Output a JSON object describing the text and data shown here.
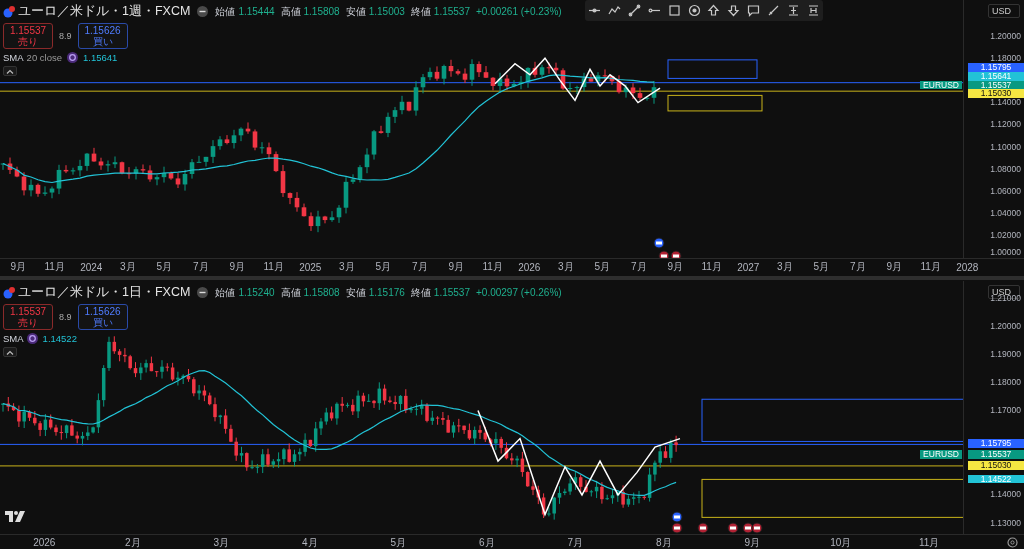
{
  "panes": [
    {
      "title": "ユーロ／米ドル・1週・FXCM",
      "ohlc": [
        {
          "label": "始値",
          "value": "1.15444"
        },
        {
          "label": "高値",
          "value": "1.15808"
        },
        {
          "label": "安値",
          "value": "1.15003"
        },
        {
          "label": "終値",
          "value": "1.15537"
        }
      ],
      "change": "+0.00261 (+0.23%)",
      "sell": {
        "price": "1.15537",
        "label": "売り"
      },
      "spread": "8.9",
      "buy": {
        "price": "1.15626",
        "label": "買い"
      },
      "indicator": {
        "name": "SMA",
        "params": "20 close",
        "value": "1.15641"
      },
      "currency": "USD",
      "price_ticks": [
        "1.20000",
        "1.18000",
        "1.14000",
        "1.12000",
        "1.10000",
        "1.08000",
        "1.06000",
        "1.04000",
        "1.02000",
        "1.00000"
      ],
      "price_tags": [
        {
          "price": "1.15795",
          "color": "#2962ff",
          "kind": "line"
        },
        {
          "price": "1.15641",
          "color": "#22c3d6",
          "kind": "sma"
        },
        {
          "price": "1.15537",
          "color": "#089981",
          "kind": "current"
        },
        {
          "price": "1.15030",
          "color": "#f5e642",
          "kind": "line"
        }
      ],
      "symbol_label": "EURUSD",
      "time_labels": [
        "9月",
        "11月",
        "2024",
        "3月",
        "5月",
        "7月",
        "9月",
        "11月",
        "2025",
        "3月",
        "5月",
        "7月",
        "9月",
        "11月",
        "2026",
        "3月",
        "5月",
        "7月",
        "9月",
        "11月",
        "2027",
        "3月",
        "5月",
        "7月",
        "9月",
        "11月",
        "2028"
      ]
    },
    {
      "title": "ユーロ／米ドル・1日・FXCM",
      "ohlc": [
        {
          "label": "始値",
          "value": "1.15240"
        },
        {
          "label": "高値",
          "value": "1.15808"
        },
        {
          "label": "安値",
          "value": "1.15176"
        },
        {
          "label": "終値",
          "value": "1.15537"
        }
      ],
      "change": "+0.00297 (+0.26%)",
      "sell": {
        "price": "1.15537",
        "label": "売り"
      },
      "spread": "8.9",
      "buy": {
        "price": "1.15626",
        "label": "買い"
      },
      "indicator": {
        "name": "SMA",
        "value": "1.14522"
      },
      "currency": "USD",
      "price_ticks": [
        "1.21000",
        "1.20000",
        "1.19000",
        "1.18000",
        "1.17000",
        "1.14000",
        "1.13000"
      ],
      "price_tags": [
        {
          "price": "1.15795",
          "color": "#2962ff",
          "kind": "line"
        },
        {
          "price": "1.15537",
          "color": "#089981",
          "kind": "current"
        },
        {
          "price": "1.15030",
          "color": "#f5e642",
          "kind": "line"
        },
        {
          "price": "1.14522",
          "color": "#22c3d6",
          "kind": "sma"
        }
      ],
      "symbol_label": "EURUSD",
      "time_labels": [
        "2026",
        "2月",
        "3月",
        "4月",
        "5月",
        "6月",
        "7月",
        "8月",
        "9月",
        "10月",
        "11月"
      ]
    }
  ]
}
